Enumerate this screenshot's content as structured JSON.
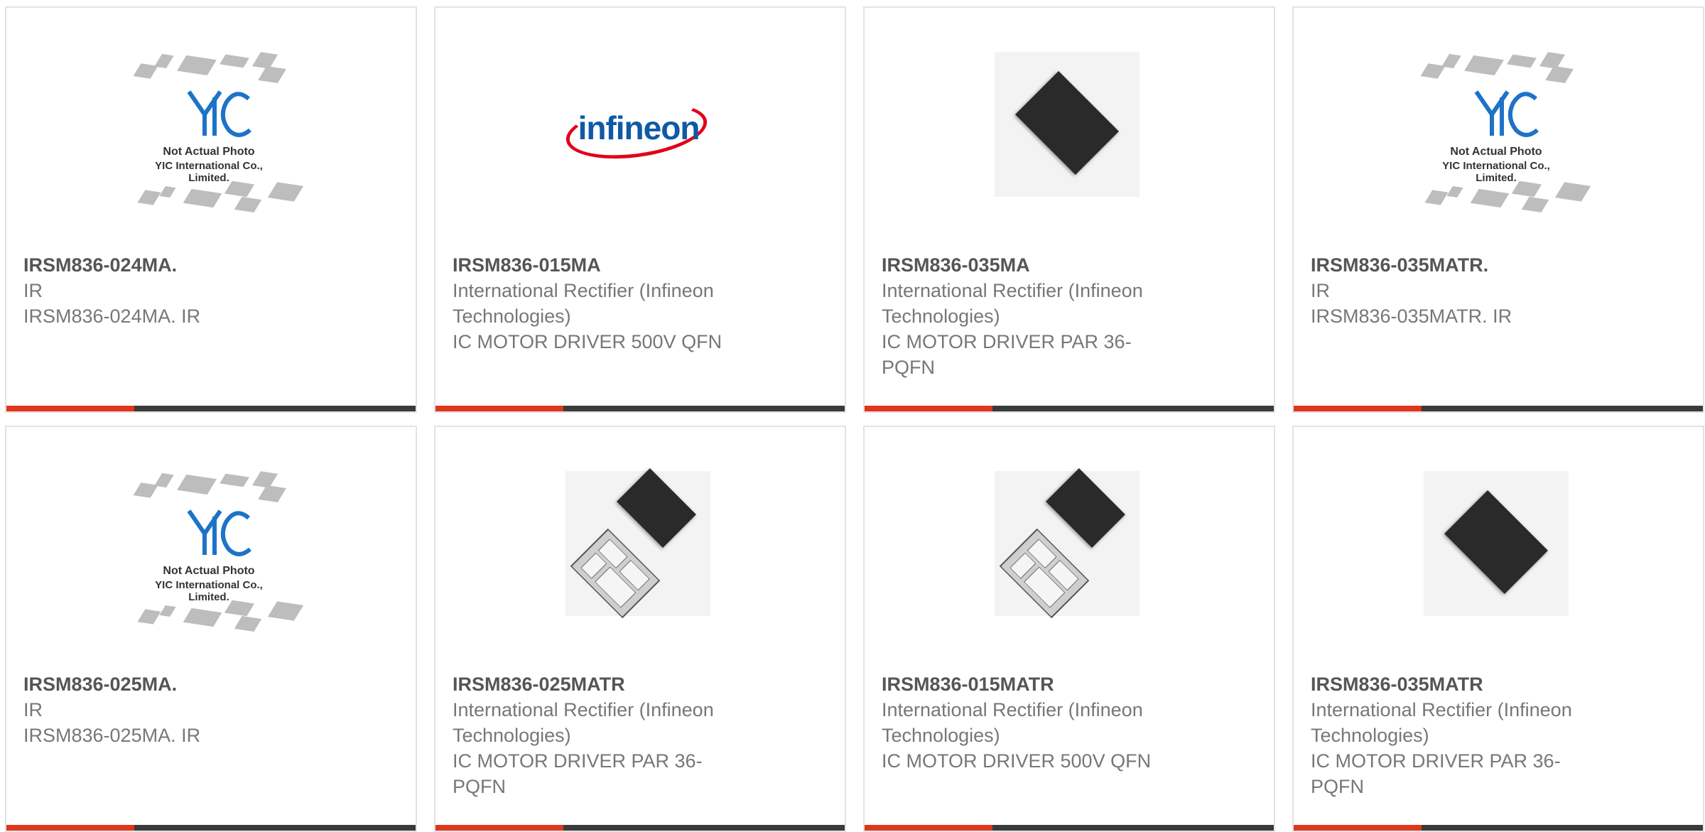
{
  "products": [
    {
      "part": "IRSM836-024MA.",
      "manufacturer": "IR",
      "description": "IRSM836-024MA. IR",
      "image": "placeholder",
      "image_caption_1": "Not Actual Photo",
      "image_caption_2": "YIC International Co., Limited."
    },
    {
      "part": "IRSM836-015MA",
      "manufacturer": "International Rectifier (Infineon Technologies)",
      "description": "IC MOTOR DRIVER 500V QFN",
      "image": "infineon-logo",
      "logo_text": "infineon"
    },
    {
      "part": "IRSM836-035MA",
      "manufacturer": "International Rectifier (Infineon Technologies)",
      "description": "IC MOTOR DRIVER PAR 36-PQFN",
      "image": "chip-top"
    },
    {
      "part": "IRSM836-035MATR.",
      "manufacturer": "IR",
      "description": "IRSM836-035MATR. IR",
      "image": "placeholder",
      "image_caption_1": "Not Actual Photo",
      "image_caption_2": "YIC International Co., Limited."
    },
    {
      "part": "IRSM836-025MA.",
      "manufacturer": "IR",
      "description": "IRSM836-025MA. IR",
      "image": "placeholder",
      "image_caption_1": "Not Actual Photo",
      "image_caption_2": "YIC International Co., Limited."
    },
    {
      "part": "IRSM836-025MATR",
      "manufacturer": "International Rectifier (Infineon Technologies)",
      "description": "IC MOTOR DRIVER PAR 36-PQFN",
      "image": "chip-both"
    },
    {
      "part": "IRSM836-015MATR",
      "manufacturer": "International Rectifier (Infineon Technologies)",
      "description": "IC MOTOR DRIVER 500V QFN",
      "image": "chip-both"
    },
    {
      "part": "IRSM836-035MATR",
      "manufacturer": "International Rectifier (Infineon Technologies)",
      "description": "IC MOTOR DRIVER PAR 36-PQFN",
      "image": "chip-top"
    }
  ],
  "colors": {
    "accent": "#e0361c",
    "bar": "#3a3a3a",
    "border": "#e3e3e3"
  }
}
